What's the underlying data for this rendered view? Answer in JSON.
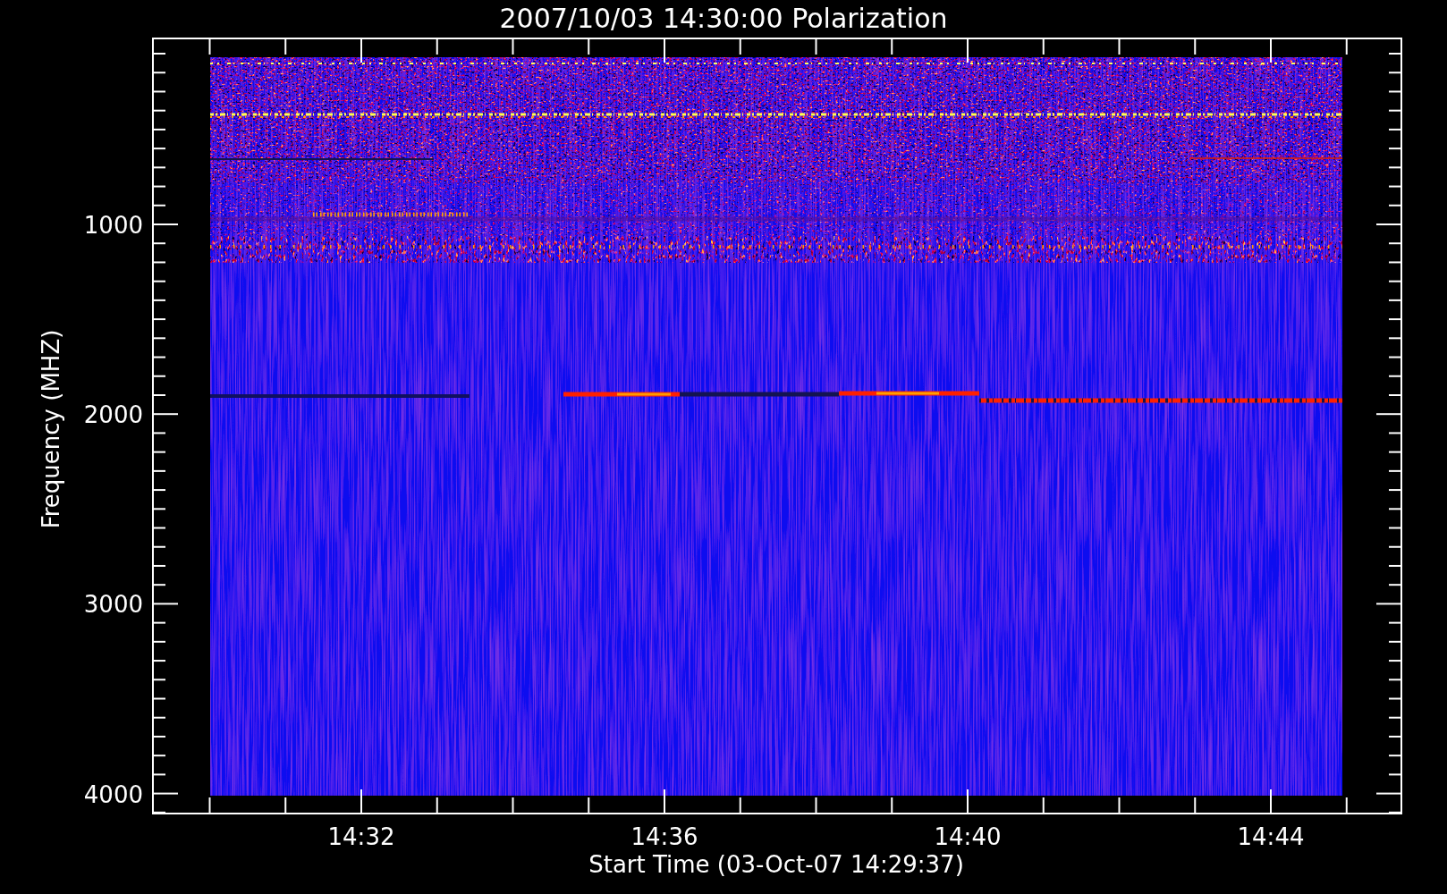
{
  "title": "2007/10/03 14:30:00 Polarization",
  "y_axis": {
    "label": "Frequency (MHZ)",
    "ticks": [
      "1000",
      "2000",
      "3000",
      "4000"
    ]
  },
  "x_axis": {
    "label": "Start Time (03-Oct-07 14:29:37)",
    "ticks": [
      "14:32",
      "14:36",
      "14:40",
      "14:44"
    ]
  }
}
